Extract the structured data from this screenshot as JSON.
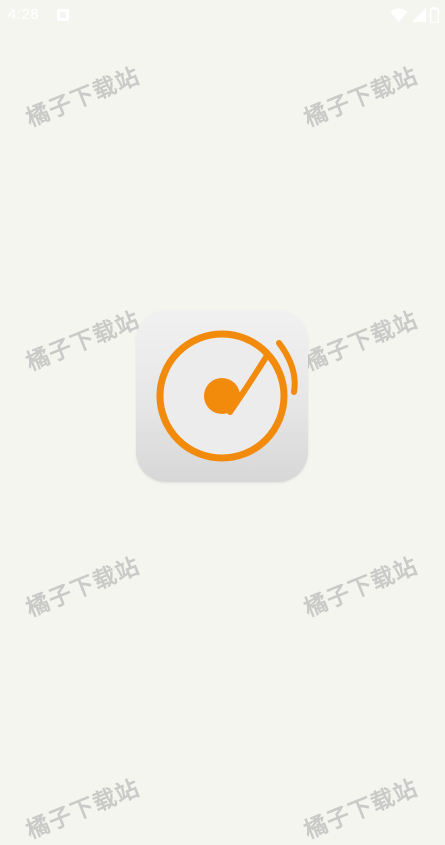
{
  "status_bar": {
    "time": "4:28",
    "icons": [
      "notification-icon",
      "wifi-icon",
      "signal-icon",
      "battery-icon"
    ]
  },
  "watermark": {
    "text": "橘子下载站",
    "color": "#969696"
  },
  "app_icon": {
    "name": "music-disc-icon",
    "accent_color": "#f28a0b"
  }
}
